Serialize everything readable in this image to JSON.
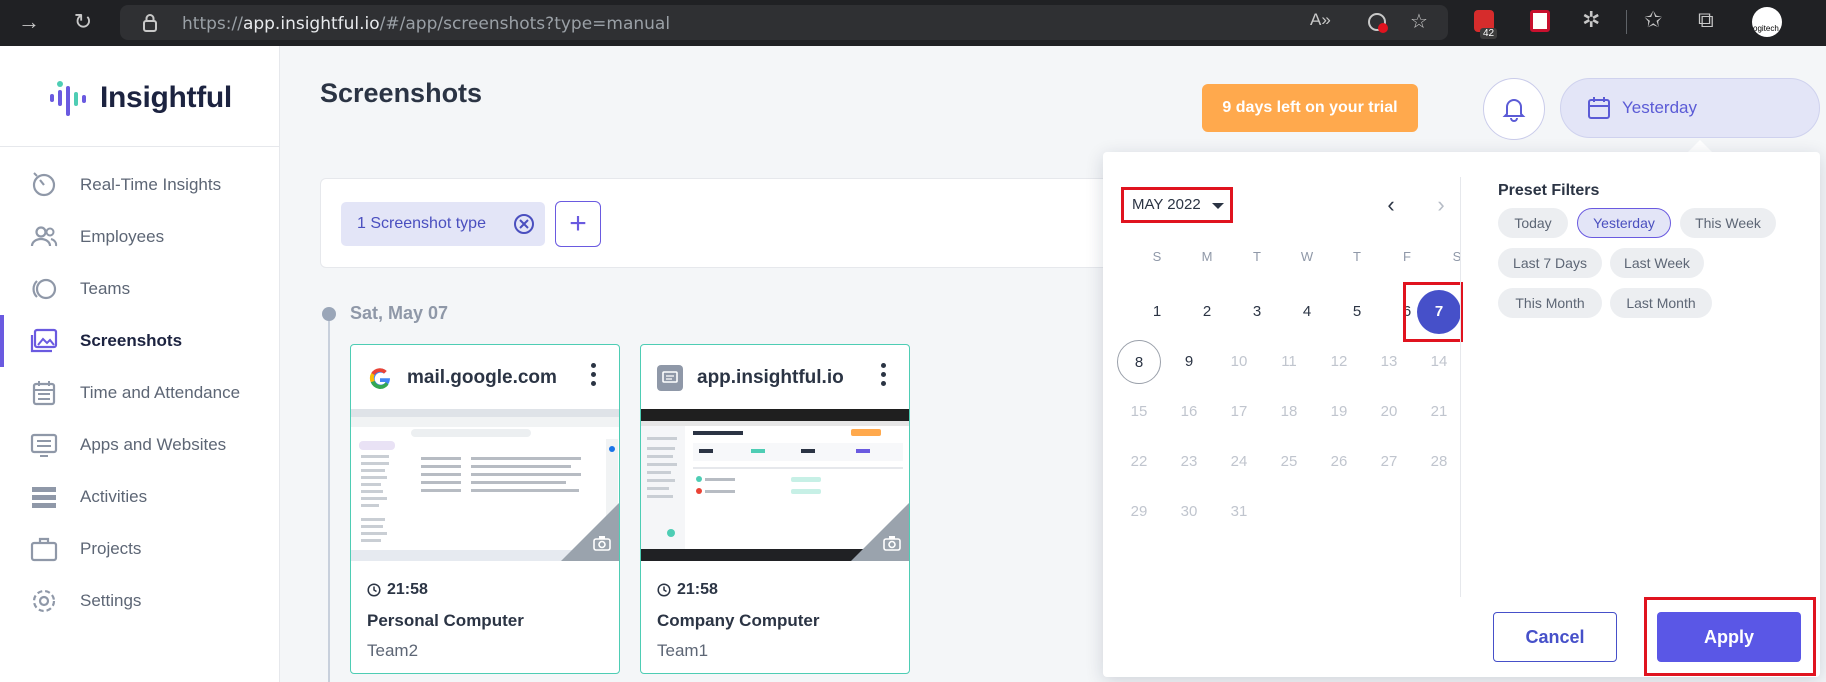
{
  "browser": {
    "url_prefix": "https://",
    "url_host": "app.insightful.io",
    "url_path": "/#/app/screenshots?type=manual",
    "extension_badge": "42",
    "profile_label": "ogitech"
  },
  "sidebar": {
    "logo_text": "Insightful",
    "items": [
      {
        "label": "Real-Time Insights",
        "icon": "realtime-icon"
      },
      {
        "label": "Employees",
        "icon": "employees-icon"
      },
      {
        "label": "Teams",
        "icon": "teams-icon"
      },
      {
        "label": "Screenshots",
        "icon": "screenshots-icon",
        "active": true
      },
      {
        "label": "Time and Attendance",
        "icon": "calendar-icon"
      },
      {
        "label": "Apps and Websites",
        "icon": "monitor-icon"
      },
      {
        "label": "Activities",
        "icon": "activities-icon"
      },
      {
        "label": "Projects",
        "icon": "briefcase-icon"
      },
      {
        "label": "Settings",
        "icon": "gear-icon"
      }
    ]
  },
  "header": {
    "title": "Screenshots",
    "trial": "9 days left on your trial",
    "date_filter": "Yesterday"
  },
  "filters": {
    "chip_label": "1 Screenshot type",
    "add_label": "+"
  },
  "timeline": {
    "date": "Sat, May 07"
  },
  "cards": [
    {
      "site": "mail.google.com",
      "time": "21:58",
      "computer": "Personal Computer",
      "team": "Team2"
    },
    {
      "site": "app.insightful.io",
      "time": "21:58",
      "computer": "Company Computer",
      "team": "Team1"
    }
  ],
  "picker": {
    "month": "MAY 2022",
    "weekdays": [
      "S",
      "M",
      "T",
      "W",
      "T",
      "F",
      "S"
    ],
    "weeks": [
      [
        "1",
        "2",
        "3",
        "4",
        "5",
        "6",
        "7"
      ],
      [
        "8",
        "9",
        "10",
        "11",
        "12",
        "13",
        "14"
      ],
      [
        "15",
        "16",
        "17",
        "18",
        "19",
        "20",
        "21"
      ],
      [
        "22",
        "23",
        "24",
        "25",
        "26",
        "27",
        "28"
      ],
      [
        "29",
        "30",
        "31"
      ]
    ],
    "selected_day": "7",
    "today": "8",
    "preset_title": "Preset Filters",
    "presets": [
      "Today",
      "Yesterday",
      "This Week",
      "Last 7 Days",
      "Last Week",
      "This Month",
      "Last Month"
    ],
    "active_preset": "Yesterday",
    "cancel": "Cancel",
    "apply": "Apply"
  },
  "colors": {
    "accent": "#5a57e6",
    "selected_day": "#4650c9",
    "trial": "#ffa94d",
    "card_border": "#4ecdb4",
    "highlight": "#e0131f"
  }
}
